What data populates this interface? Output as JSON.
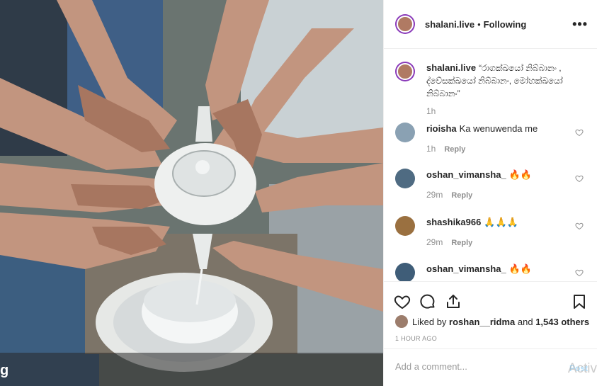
{
  "header": {
    "username": "shalani.live",
    "separator": "•",
    "follow_state": "Following",
    "more_icon": "more-options-icon",
    "more_label": "•••"
  },
  "caption": {
    "username": "shalani.live",
    "text": "“රාගක්ඛයෝ නිබ්බානං , ද්වේසක්ඛයෝ නිබ්බානං, මෝහක්ඛයෝ නිබ්බානං”",
    "time": "1h"
  },
  "comments": [
    {
      "username": "rioisha",
      "text": "Ka wenuwenda me",
      "time": "1h",
      "reply": "Reply"
    },
    {
      "username": "oshan_vimansha_",
      "text": "🔥🔥",
      "time": "29m",
      "reply": "Reply"
    },
    {
      "username": "shashika966",
      "text": "🙏🙏🙏",
      "time": "29m",
      "reply": "Reply"
    },
    {
      "username": "oshan_vimansha_",
      "text": "🔥🔥",
      "time": "",
      "reply": ""
    }
  ],
  "likes": {
    "prefix": "Liked by",
    "user": "roshan__ridma",
    "middle": "and",
    "others": "1,543 others"
  },
  "post_time": "1 HOUR AGO",
  "add_comment": {
    "placeholder": "Add a comment...",
    "post_label": "Post"
  },
  "photo": {
    "overlay_text": "g"
  },
  "watermark": "Activ",
  "colors": {
    "link_blue_disabled": "#b2dffc",
    "muted": "#8e8e8e",
    "text": "#262626",
    "story_ring": "#8a3ab9"
  }
}
